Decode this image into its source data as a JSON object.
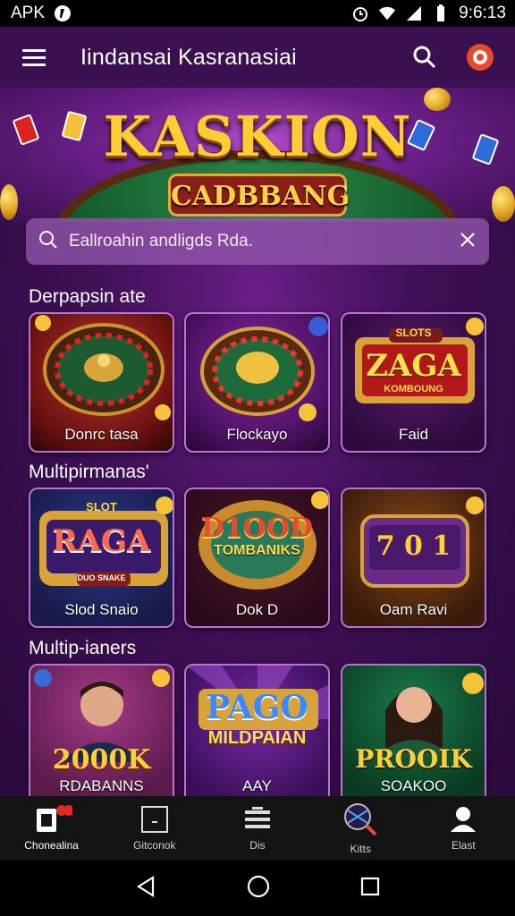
{
  "status_bar": {
    "carrier": "APK",
    "time": "9:6:13"
  },
  "app_bar": {
    "title": "Iindansai Kasranasiai"
  },
  "banner": {
    "title": "KASKION",
    "subtitle": "CADBBANG"
  },
  "search": {
    "value": "Eallroahin andligds Rda."
  },
  "sections": [
    {
      "title": "Derpapsin ate",
      "tiles": [
        {
          "label": "Donrc tasa",
          "art_text": ""
        },
        {
          "label": "Flockayo",
          "art_text": ""
        },
        {
          "label": "Faid",
          "art_text": "ZAGA",
          "art_top": "SLOTS",
          "art_sub": "KOMBOUNG"
        }
      ]
    },
    {
      "title": "Multipirmanas'",
      "tiles": [
        {
          "label": "Slod Snaio",
          "art_text": "RAGA",
          "art_top": "SLOT",
          "art_sub": "DUO SNAKE"
        },
        {
          "label": "Dok D",
          "art_text": "D1OOD",
          "art_sub": "TOMBANIKS"
        },
        {
          "label": "Oam Ravi",
          "art_text": "7 0 1"
        }
      ]
    },
    {
      "title": "Multip-ianers",
      "tiles": [
        {
          "label": "RDABANNS",
          "art_text": "2000K"
        },
        {
          "label": "AAY",
          "art_text": "PAGO",
          "art_sub": "MILDPAIAN"
        },
        {
          "label": "SOAKOO",
          "art_text": "PROOIK"
        }
      ]
    }
  ],
  "bottom_nav": [
    {
      "label": "Chonealina",
      "icon": "casino-home-icon",
      "badge": ""
    },
    {
      "label": "Gitconok",
      "icon": "slot-box-icon"
    },
    {
      "label": "Dis",
      "icon": "stack-icon"
    },
    {
      "label": "Kitts",
      "icon": "search-globe-icon"
    },
    {
      "label": "Elast",
      "icon": "profile-icon"
    }
  ],
  "colors": {
    "accent": "#ffcc33",
    "bg": "#3a1050"
  }
}
